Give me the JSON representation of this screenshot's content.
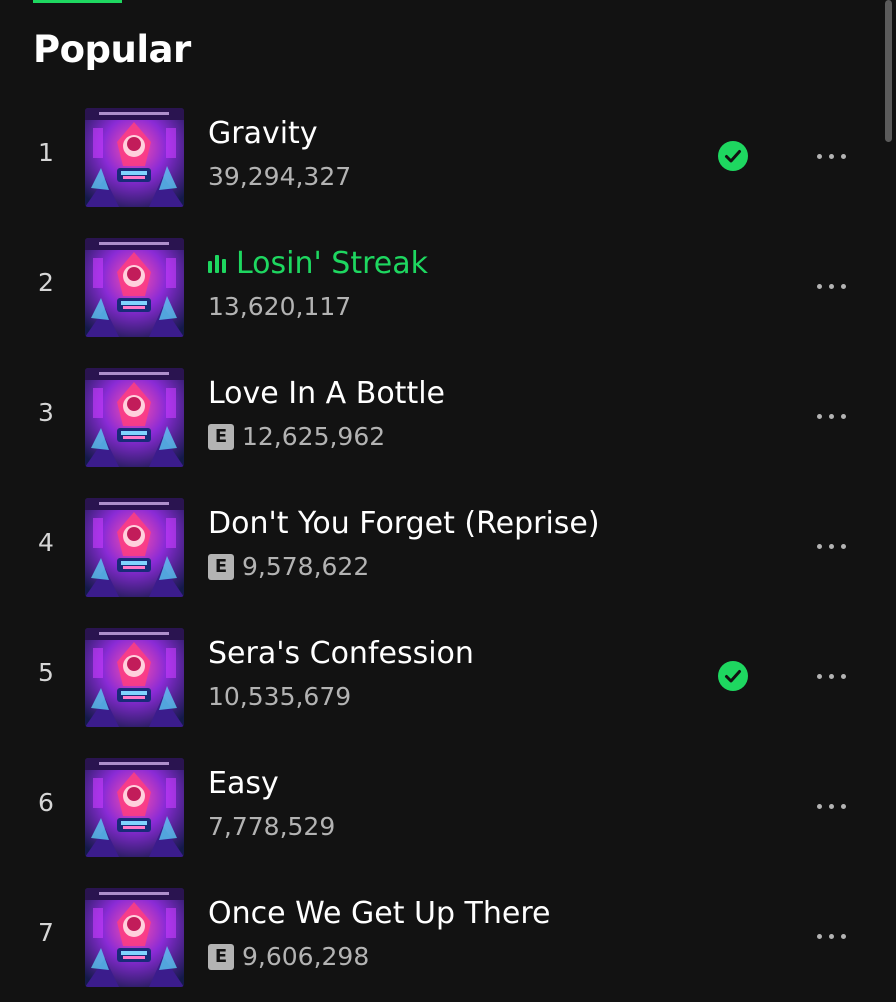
{
  "section": {
    "title": "Popular"
  },
  "colors": {
    "accent": "#1ed760",
    "background": "#121212",
    "text_primary": "#ffffff",
    "text_secondary": "#b3b3b3"
  },
  "tracks": [
    {
      "index": "1",
      "title": "Gravity",
      "plays": "39,294,327",
      "explicit": false,
      "saved": true,
      "playing": false
    },
    {
      "index": "2",
      "title": "Losin' Streak",
      "plays": "13,620,117",
      "explicit": false,
      "saved": false,
      "playing": true
    },
    {
      "index": "3",
      "title": "Love In A Bottle",
      "plays": "12,625,962",
      "explicit": true,
      "saved": false,
      "playing": false
    },
    {
      "index": "4",
      "title": "Don't You Forget (Reprise)",
      "plays": "9,578,622",
      "explicit": true,
      "saved": false,
      "playing": false
    },
    {
      "index": "5",
      "title": "Sera's Confession",
      "plays": "10,535,679",
      "explicit": false,
      "saved": true,
      "playing": false
    },
    {
      "index": "6",
      "title": "Easy",
      "plays": "7,778,529",
      "explicit": false,
      "saved": false,
      "playing": false
    },
    {
      "index": "7",
      "title": "Once We Get Up There",
      "plays": "9,606,298",
      "explicit": true,
      "saved": false,
      "playing": false
    }
  ],
  "badges": {
    "explicit_label": "E"
  },
  "icons": {
    "saved": "check-circle-icon",
    "playing": "equalizer-icon",
    "more": "more-options-icon"
  }
}
